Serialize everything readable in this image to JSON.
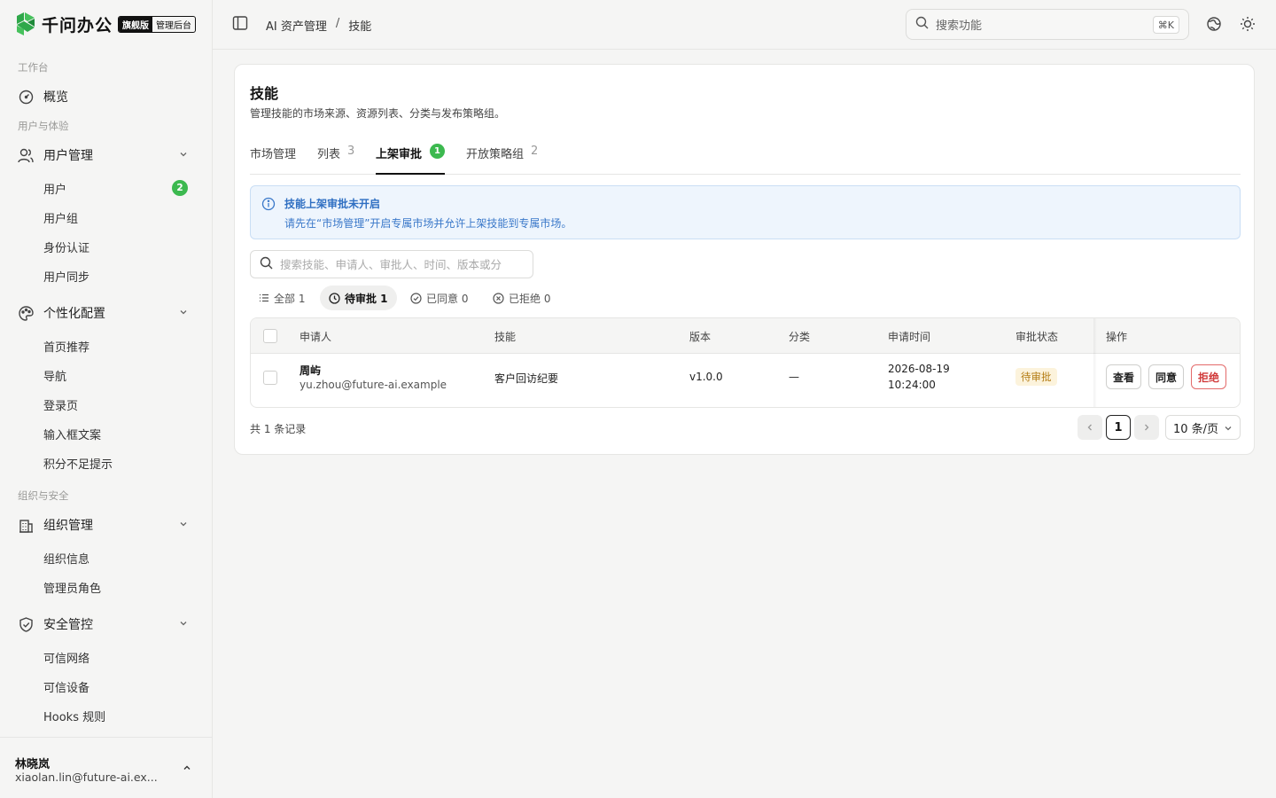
{
  "app": {
    "name": "千问办公",
    "badge_edition": "旗舰版",
    "badge_console": "管理后台"
  },
  "sidebar": {
    "sections": {
      "workbench": "工作台",
      "users_exp": "用户与体验",
      "org_sec": "组织与安全"
    },
    "overview": "概览",
    "user_mgmt": {
      "label": "用户管理",
      "items": [
        "用户",
        "用户组",
        "身份认证",
        "用户同步"
      ],
      "users_badge": "2"
    },
    "personal": {
      "label": "个性化配置",
      "items": [
        "首页推荐",
        "导航",
        "登录页",
        "输入框文案",
        "积分不足提示"
      ]
    },
    "org_mgmt": {
      "label": "组织管理",
      "items": [
        "组织信息",
        "管理员角色"
      ]
    },
    "security": {
      "label": "安全管控",
      "items": [
        "可信网络",
        "可信设备",
        "Hooks 规则"
      ]
    },
    "user": {
      "name": "林晓岚",
      "email": "xiaolan.lin@future-ai.ex..."
    }
  },
  "topbar": {
    "breadcrumb": [
      "AI 资产管理",
      "技能"
    ],
    "search_placeholder": "搜索功能",
    "shortcut": "⌘K"
  },
  "page": {
    "title": "技能",
    "description": "管理技能的市场来源、资源列表、分类与发布策略组。",
    "tabs": [
      {
        "label": "市场管理",
        "count": ""
      },
      {
        "label": "列表",
        "count": "3"
      },
      {
        "label": "上架审批",
        "count": "1"
      },
      {
        "label": "开放策略组",
        "count": "2"
      }
    ],
    "alert": {
      "title": "技能上架审批未开启",
      "message": "请先在“市场管理”开启专属市场并允许上架技能到专属市场。"
    },
    "search_placeholder": "搜索技能、申请人、审批人、时间、版本或分类",
    "filters": [
      {
        "label": "全部 1"
      },
      {
        "label": "待审批 1"
      },
      {
        "label": "已同意 0"
      },
      {
        "label": "已拒绝 0"
      }
    ],
    "table": {
      "columns": [
        "申请人",
        "技能",
        "版本",
        "分类",
        "申请时间",
        "审批状态",
        "操作"
      ],
      "rows": [
        {
          "applicant_name": "周屿",
          "applicant_email": "yu.zhou@future-ai.example",
          "skill": "客户回访纪要",
          "version": "v1.0.0",
          "category": "—",
          "date": "2026-08-19",
          "time": "10:24:00",
          "status": "待审批",
          "actions": [
            "查看",
            "同意",
            "拒绝"
          ]
        }
      ]
    },
    "total": "共 1 条记录",
    "pagination": {
      "current": "1",
      "page_size": "10 条/页"
    }
  },
  "colors": {
    "accent_green": "#3cb94f",
    "info_blue": "#2f6fc2",
    "pending": "#b37b12",
    "danger": "#d13b3b"
  }
}
